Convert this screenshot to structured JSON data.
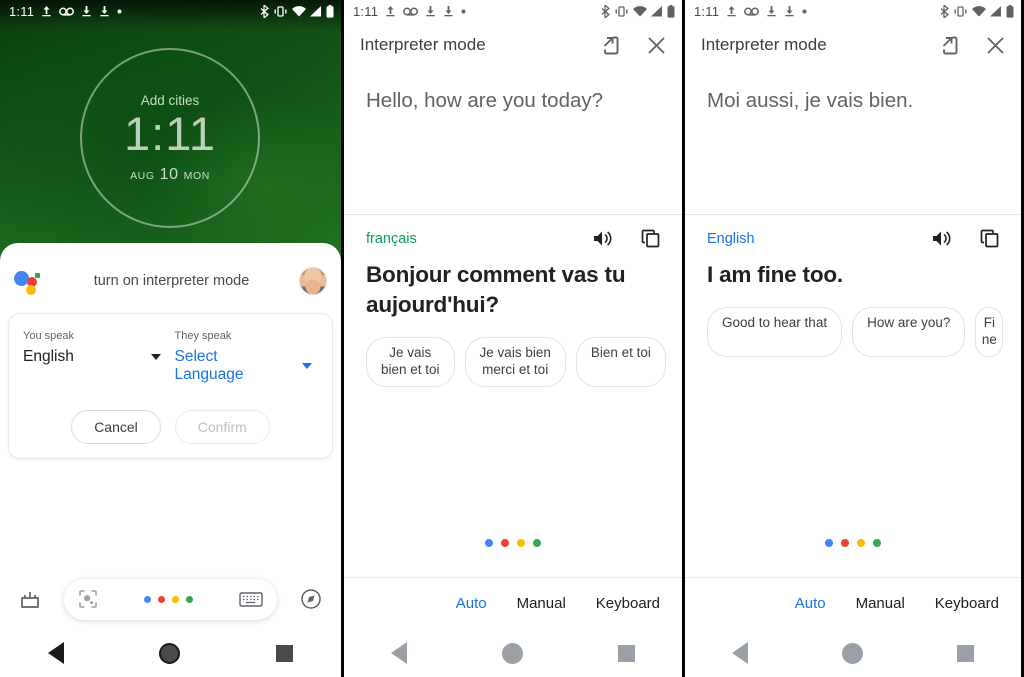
{
  "statusbar": {
    "time": "1:11",
    "left_icons": [
      "upload-icon",
      "voicemail-icon",
      "download-icon",
      "download-icon",
      "dot-icon"
    ],
    "right_icons": [
      "bluetooth-icon",
      "vibrate-icon",
      "wifi-icon",
      "signal-icon",
      "battery-icon"
    ]
  },
  "panel1": {
    "clock_widget": {
      "add_cities": "Add cities",
      "time": "1:11",
      "month": "AUG",
      "day": "10",
      "weekday": "MON"
    },
    "assistant": {
      "query": "turn on interpreter mode",
      "logo": "google-assistant-logo",
      "avatar": "user-avatar"
    },
    "language_card": {
      "you_speak_label": "You speak",
      "you_speak_value": "English",
      "they_speak_label": "They speak",
      "they_speak_value": "Select Language",
      "cancel": "Cancel",
      "confirm": "Confirm"
    },
    "assistant_bar": {
      "snapshot_icon": "snapshot-icon",
      "lens_icon": "google-lens-icon",
      "keyboard_icon": "keyboard-icon",
      "explore_icon": "explore-compass-icon",
      "dot_colors": [
        "#4285f4",
        "#ea4335",
        "#fbbc05",
        "#34a853"
      ]
    }
  },
  "panel2": {
    "header": {
      "title": "Interpreter mode",
      "open_on_phone_icon": "open-on-phone-icon",
      "close_icon": "close-icon"
    },
    "source_text": "Hello, how are you today?",
    "translation": {
      "language": "français",
      "language_color": "#0f9d58",
      "text": "Bonjour comment vas tu aujourd'hui?",
      "speaker_icon": "speaker-icon",
      "copy_icon": "copy-icon"
    },
    "chips": [
      "Je vais\nbien et toi",
      "Je vais bien\nmerci et toi",
      "Bien et toi"
    ],
    "listening_dots": [
      "#4285f4",
      "#ea4335",
      "#fbbc05",
      "#34a853"
    ],
    "modes": [
      {
        "label": "Auto",
        "active": true
      },
      {
        "label": "Manual",
        "active": false
      },
      {
        "label": "Keyboard",
        "active": false
      }
    ]
  },
  "panel3": {
    "header": {
      "title": "Interpreter mode",
      "open_on_phone_icon": "open-on-phone-icon",
      "close_icon": "close-icon"
    },
    "source_text": "Moi aussi, je vais bien.",
    "translation": {
      "language": "English",
      "language_color": "#1a73e8",
      "text": "I am fine too.",
      "speaker_icon": "speaker-icon",
      "copy_icon": "copy-icon"
    },
    "chips": [
      "Good to hear that",
      "How are you?",
      "Fine"
    ],
    "listening_dots": [
      "#4285f4",
      "#ea4335",
      "#fbbc05",
      "#34a853"
    ],
    "modes": [
      {
        "label": "Auto",
        "active": true
      },
      {
        "label": "Manual",
        "active": false
      },
      {
        "label": "Keyboard",
        "active": false
      }
    ]
  },
  "navbar": {
    "back_icon": "back-triangle-icon",
    "home_icon": "home-circle-icon",
    "recents_icon": "recents-square-icon"
  }
}
